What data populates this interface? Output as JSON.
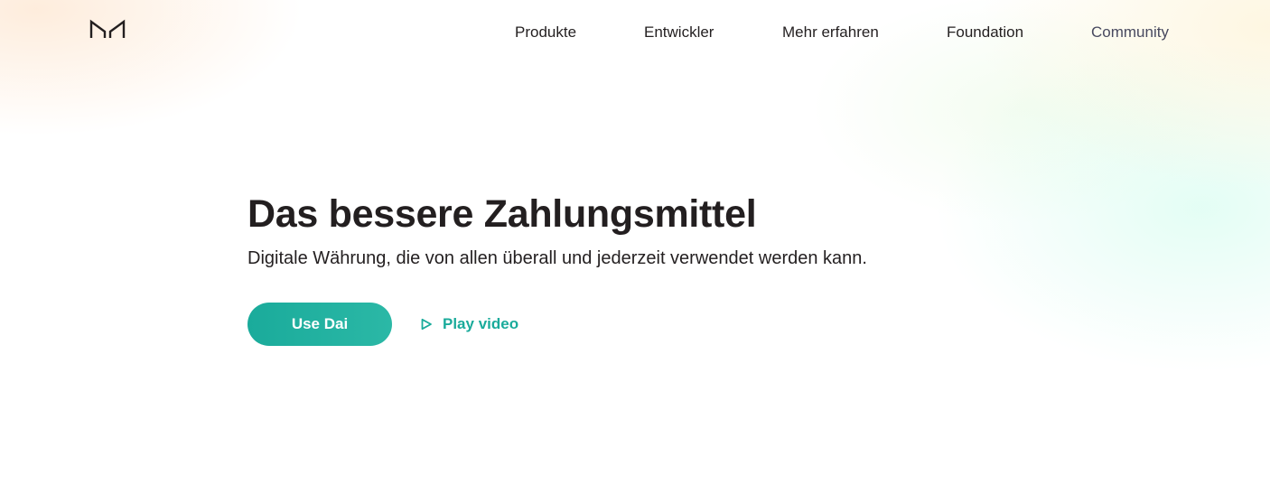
{
  "brand": {
    "logo_icon": "maker-logo-icon"
  },
  "nav": {
    "items": [
      {
        "label": "Produkte"
      },
      {
        "label": "Entwickler"
      },
      {
        "label": "Mehr erfahren"
      },
      {
        "label": "Foundation"
      },
      {
        "label": "Community"
      }
    ]
  },
  "hero": {
    "title": "Das bessere Zahlungsmittel",
    "subtitle": "Digitale Währung, die von allen überall und jederzeit verwendet werden kann.",
    "primary_cta": "Use Dai",
    "secondary_cta": "Play video",
    "secondary_icon": "play-icon"
  },
  "colors": {
    "accent": "#1aab9b",
    "text": "#231f20",
    "nav_muted": "#48495f",
    "background": "#ffffff"
  }
}
